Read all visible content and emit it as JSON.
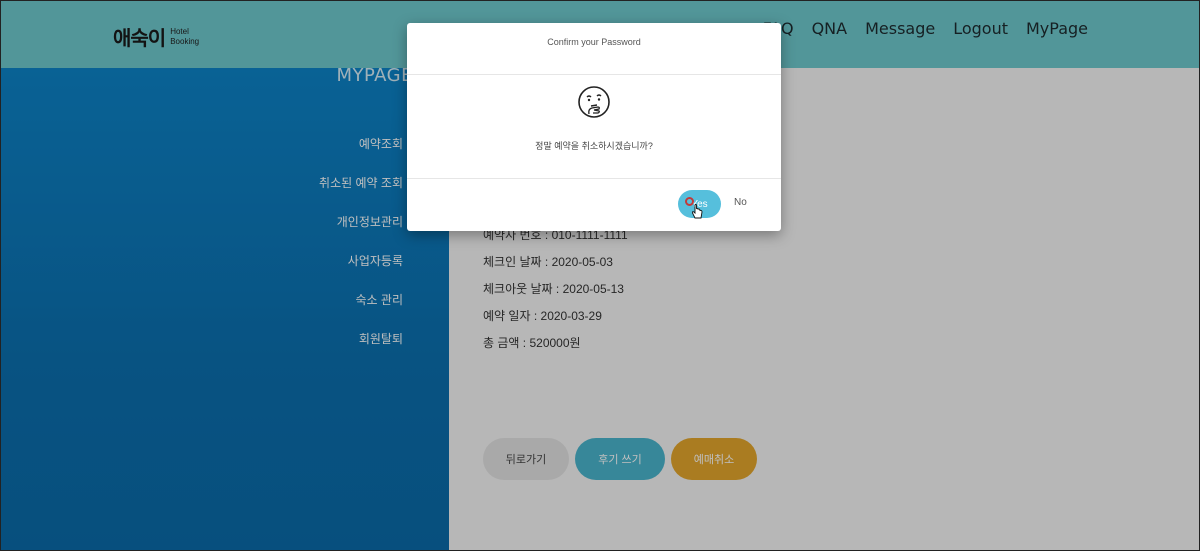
{
  "header": {
    "logo_main": "애숙이",
    "logo_sub_line1": "Hotel",
    "logo_sub_line2": "Booking",
    "nav": [
      "FAQ",
      "QNA",
      "Message",
      "Logout",
      "MyPage"
    ]
  },
  "sidebar": {
    "title": "MYPAGE",
    "items": [
      "예약조회",
      "취소된 예약 조회",
      "개인정보관리",
      "사업자등록",
      "숙소 관리",
      "회원탈퇴"
    ]
  },
  "reservation": {
    "rows": [
      {
        "label": "예약자 번호",
        "value": "010-1111-1111"
      },
      {
        "label": "체크인 날짜",
        "value": "2020-05-03"
      },
      {
        "label": "체크아웃 날짜",
        "value": "2020-05-13"
      },
      {
        "label": "예약 일자",
        "value": "2020-03-29"
      },
      {
        "label": "총 금액",
        "value": "520000원"
      }
    ]
  },
  "actions": {
    "back": "뒤로가기",
    "review": "후기 쓰기",
    "cancel": "예매취소"
  },
  "modal": {
    "title": "Confirm your Password",
    "message": "정말 예약을 취소하시겠습니까?",
    "yes": "Yes",
    "no": "No",
    "icon": "thinking-face-icon"
  },
  "colors": {
    "header": "#6ec8cc",
    "sidebar": "#0b78bb",
    "yes_button": "#56bfdc",
    "review_button": "#4ab5cc",
    "cancel_button": "#e3a62c"
  }
}
